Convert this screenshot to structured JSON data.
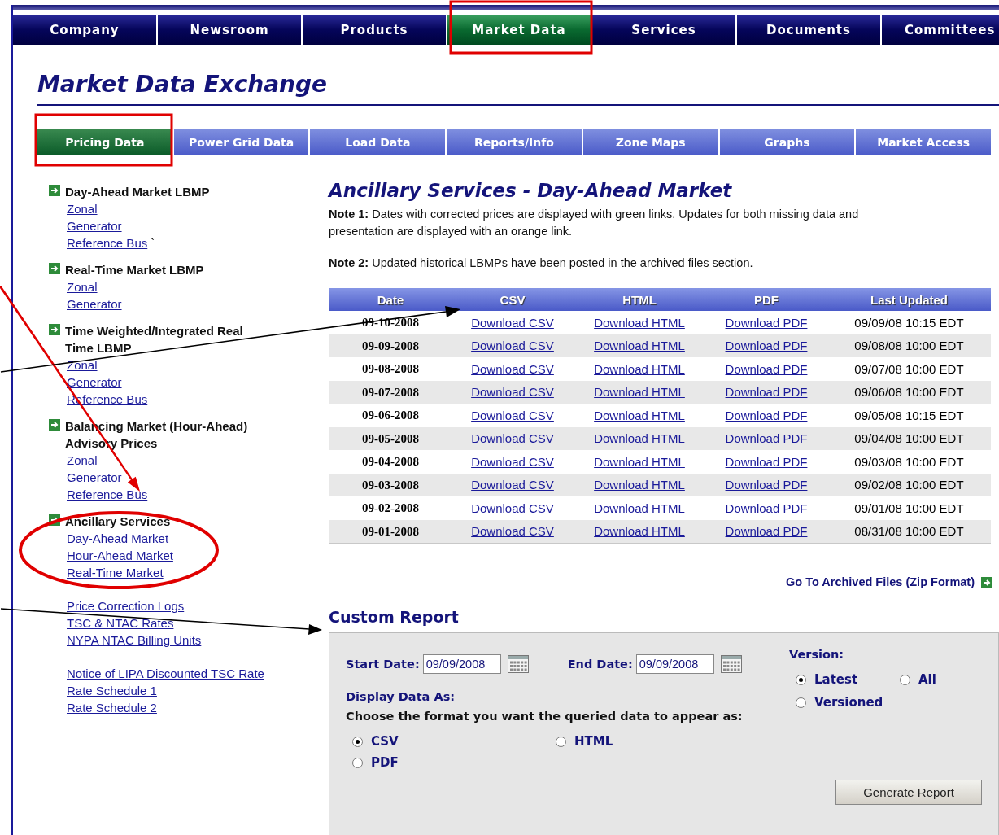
{
  "nav": [
    {
      "label": "Company",
      "selected": false
    },
    {
      "label": "Newsroom",
      "selected": false
    },
    {
      "label": "Products",
      "selected": false
    },
    {
      "label": "Market Data",
      "selected": true
    },
    {
      "label": "Services",
      "selected": false
    },
    {
      "label": "Documents",
      "selected": false
    },
    {
      "label": "Committees",
      "selected": false
    }
  ],
  "page_title": "Market Data Exchange",
  "subtabs": [
    {
      "label": "Pricing Data",
      "selected": true
    },
    {
      "label": "Power Grid Data",
      "selected": false
    },
    {
      "label": "Load Data",
      "selected": false
    },
    {
      "label": "Reports/Info",
      "selected": false
    },
    {
      "label": "Zone Maps",
      "selected": false
    },
    {
      "label": "Graphs",
      "selected": false
    },
    {
      "label": "Market Access",
      "selected": false
    }
  ],
  "sidebar": {
    "sections": [
      {
        "heading": "Day-Ahead Market LBMP",
        "links": [
          "Zonal",
          "Generator",
          "Reference Bus"
        ],
        "suffix": "`"
      },
      {
        "heading": "Real-Time Market LBMP",
        "links": [
          "Zonal",
          "Generator"
        ]
      },
      {
        "heading": "Time Weighted/Integrated Real Time LBMP",
        "links": [
          "Zonal",
          "Generator",
          "Reference Bus"
        ]
      },
      {
        "heading": "Balancing Market (Hour-Ahead) Advisory Prices",
        "links": [
          "Zonal",
          "Generator",
          "Reference Bus"
        ]
      },
      {
        "heading": "Ancillary Services",
        "links": [
          "Day-Ahead Market",
          "Hour-Ahead Market",
          "Real-Time Market"
        ]
      }
    ],
    "link_groups": [
      [
        "Price Correction Logs",
        "TSC & NTAC Rates",
        "NYPA NTAC Billing Units"
      ],
      [
        "Notice of LIPA Discounted TSC Rate",
        "Rate Schedule 1",
        "Rate Schedule 2"
      ]
    ]
  },
  "content_title": "Ancillary Services - Day-Ahead Market",
  "notes": [
    "**Note 1:** Dates with corrected prices are displayed with green links. Updates for both missing data and presentation are displayed with an orange link.",
    "**Note 2:** Updated historical LBMPs have been posted in the archived files section."
  ],
  "table": {
    "columns": [
      "Date",
      "CSV",
      "HTML",
      "PDF",
      "Last Updated"
    ],
    "rows": [
      [
        "09-10-2008",
        "Download CSV",
        "Download HTML",
        "Download PDF",
        "09/09/08 10:15 EDT"
      ],
      [
        "09-09-2008",
        "Download CSV",
        "Download HTML",
        "Download PDF",
        "09/08/08 10:00 EDT"
      ],
      [
        "09-08-2008",
        "Download CSV",
        "Download HTML",
        "Download PDF",
        "09/07/08 10:00 EDT"
      ],
      [
        "09-07-2008",
        "Download CSV",
        "Download HTML",
        "Download PDF",
        "09/06/08 10:00 EDT"
      ],
      [
        "09-06-2008",
        "Download CSV",
        "Download HTML",
        "Download PDF",
        "09/05/08 10:15 EDT"
      ],
      [
        "09-05-2008",
        "Download CSV",
        "Download HTML",
        "Download PDF",
        "09/04/08 10:00 EDT"
      ],
      [
        "09-04-2008",
        "Download CSV",
        "Download HTML",
        "Download PDF",
        "09/03/08 10:00 EDT"
      ],
      [
        "09-03-2008",
        "Download CSV",
        "Download HTML",
        "Download PDF",
        "09/02/08 10:00 EDT"
      ],
      [
        "09-02-2008",
        "Download CSV",
        "Download HTML",
        "Download PDF",
        "09/01/08 10:00 EDT"
      ],
      [
        "09-01-2008",
        "Download CSV",
        "Download HTML",
        "Download PDF",
        "08/31/08 10:00 EDT"
      ]
    ]
  },
  "archive_link": "Go To Archived Files (Zip Format)",
  "custom_report": {
    "title": "Custom Report",
    "start_date": {
      "label": "Start Date:",
      "value": "09/09/2008"
    },
    "end_date": {
      "label": "End Date:",
      "value": "09/09/2008"
    },
    "version": {
      "label": "Version:",
      "options": [
        {
          "label": "Latest",
          "selected": true
        },
        {
          "label": "All",
          "selected": false
        },
        {
          "label": "Versioned",
          "selected": false
        }
      ]
    },
    "display_label": "Display Data As:",
    "format_prompt": "Choose the format you want the queried data to appear as:",
    "formats": [
      {
        "label": "CSV",
        "selected": true
      },
      {
        "label": "HTML",
        "selected": false
      },
      {
        "label": "PDF",
        "selected": false
      }
    ],
    "button": "Generate Report"
  }
}
